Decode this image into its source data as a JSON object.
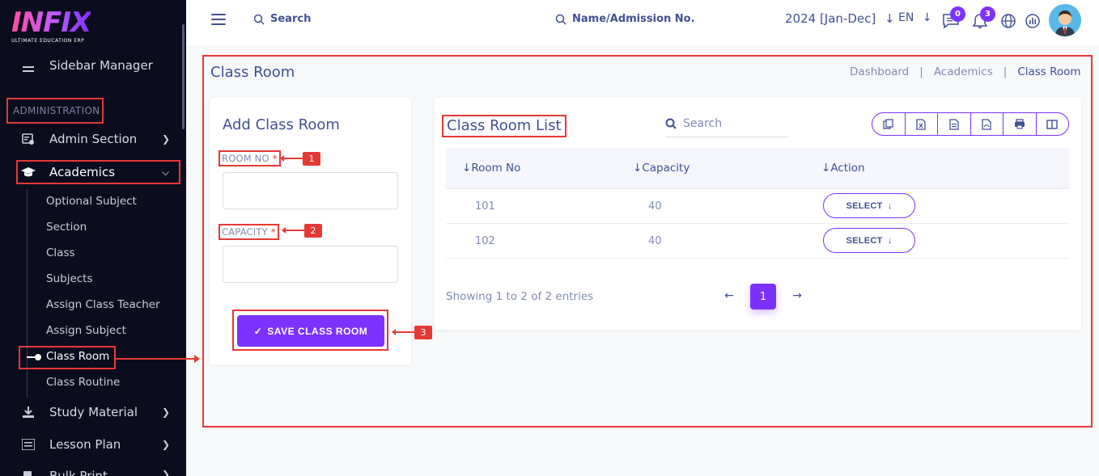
{
  "brand": {
    "logo_text": "INFIX",
    "tagline": "ULTIMATE EDUCATION ERP"
  },
  "sidebar": {
    "sidebar_manager": "Sidebar Manager",
    "section_head": "ADMINISTRATION",
    "items": [
      {
        "label": "Admin Section",
        "icon": "admin-icon"
      },
      {
        "label": "Academics",
        "icon": "graduation-cap-icon"
      },
      {
        "label": "Study Material",
        "icon": "download-icon"
      },
      {
        "label": "Lesson Plan",
        "icon": "list-icon"
      },
      {
        "label": "Bulk Print",
        "icon": "print-icon"
      }
    ],
    "academics_sub": [
      "Optional Subject",
      "Section",
      "Class",
      "Subjects",
      "Assign Class Teacher",
      "Assign Subject",
      "Class Room",
      "Class Routine"
    ],
    "active_sub": "Class Room"
  },
  "header": {
    "search_label": "Search",
    "admission_search": "Name/Admission No.",
    "year": "2024 [Jan-Dec]",
    "lang": "EN",
    "message_count": "0",
    "notification_count": "3"
  },
  "page": {
    "title": "Class Room",
    "breadcrumbs": [
      "Dashboard",
      "Academics",
      "Class Room"
    ]
  },
  "add_form": {
    "title": "Add Class Room",
    "room_no_label": "ROOM NO",
    "capacity_label": "CAPACITY",
    "required_mark": "*",
    "save_label": "SAVE CLASS ROOM",
    "callouts": [
      "1",
      "2",
      "3"
    ]
  },
  "list": {
    "title": "Class Room List",
    "search_placeholder": "Search",
    "columns": [
      "Room No",
      "Capacity",
      "Action"
    ],
    "rows": [
      {
        "room_no": "101",
        "capacity": "40",
        "action": "SELECT"
      },
      {
        "room_no": "102",
        "capacity": "40",
        "action": "SELECT"
      }
    ],
    "showing": "Showing 1 to 2 of 2 entries",
    "current_page": "1"
  },
  "colors": {
    "primary": "#7c32ff",
    "text": "#415094",
    "muted": "#828bb2",
    "annotation": "#e53935",
    "sidebar_bg": "#0c0c1f"
  }
}
